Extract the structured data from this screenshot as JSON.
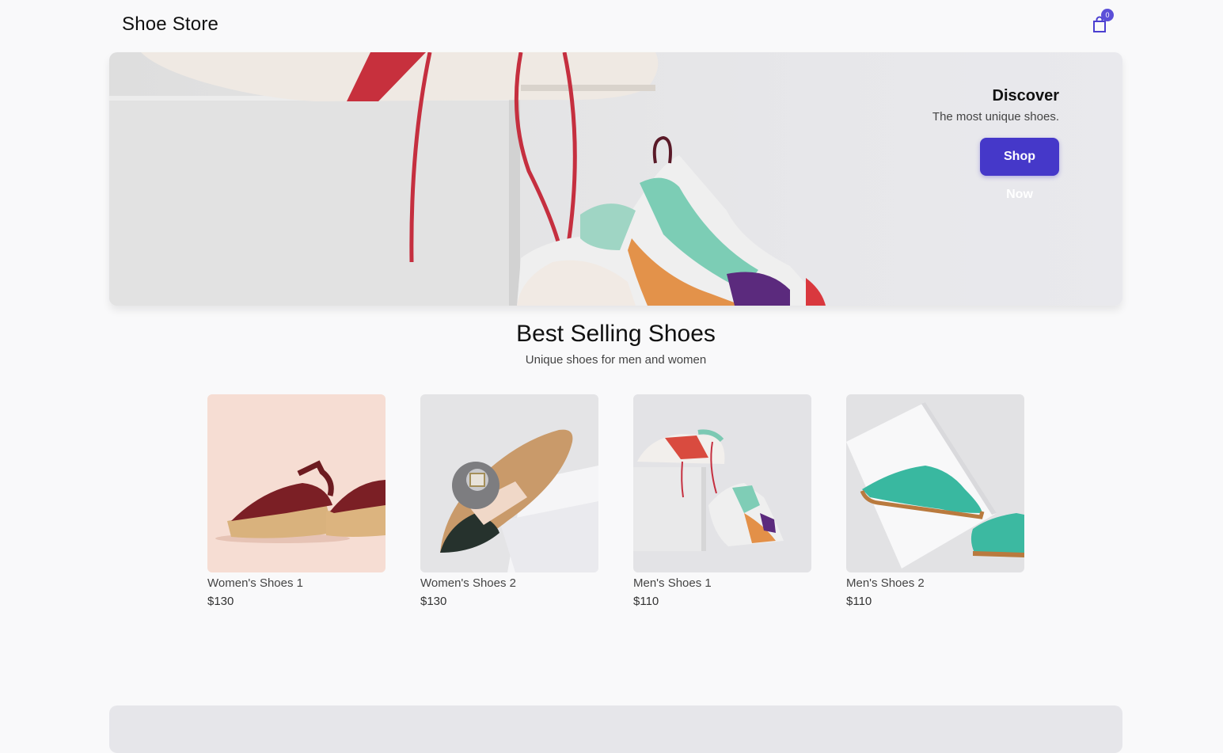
{
  "header": {
    "logo": "Shoe Store",
    "cart_count": "0"
  },
  "hero": {
    "title": "Discover",
    "subtitle": "The most unique shoes.",
    "cta": "Shop Now"
  },
  "section": {
    "title": "Best Selling Shoes",
    "subtitle": "Unique shoes for men and women"
  },
  "products": [
    {
      "name": "Women's Shoes 1",
      "price": "$130"
    },
    {
      "name": "Women's Shoes 2",
      "price": "$130"
    },
    {
      "name": "Men's Shoes 1",
      "price": "$110"
    },
    {
      "name": "Men's Shoes 2",
      "price": "$110"
    }
  ],
  "colors": {
    "accent": "#4538c9",
    "badge": "#5b4fd8",
    "background": "#f9f9fa"
  }
}
